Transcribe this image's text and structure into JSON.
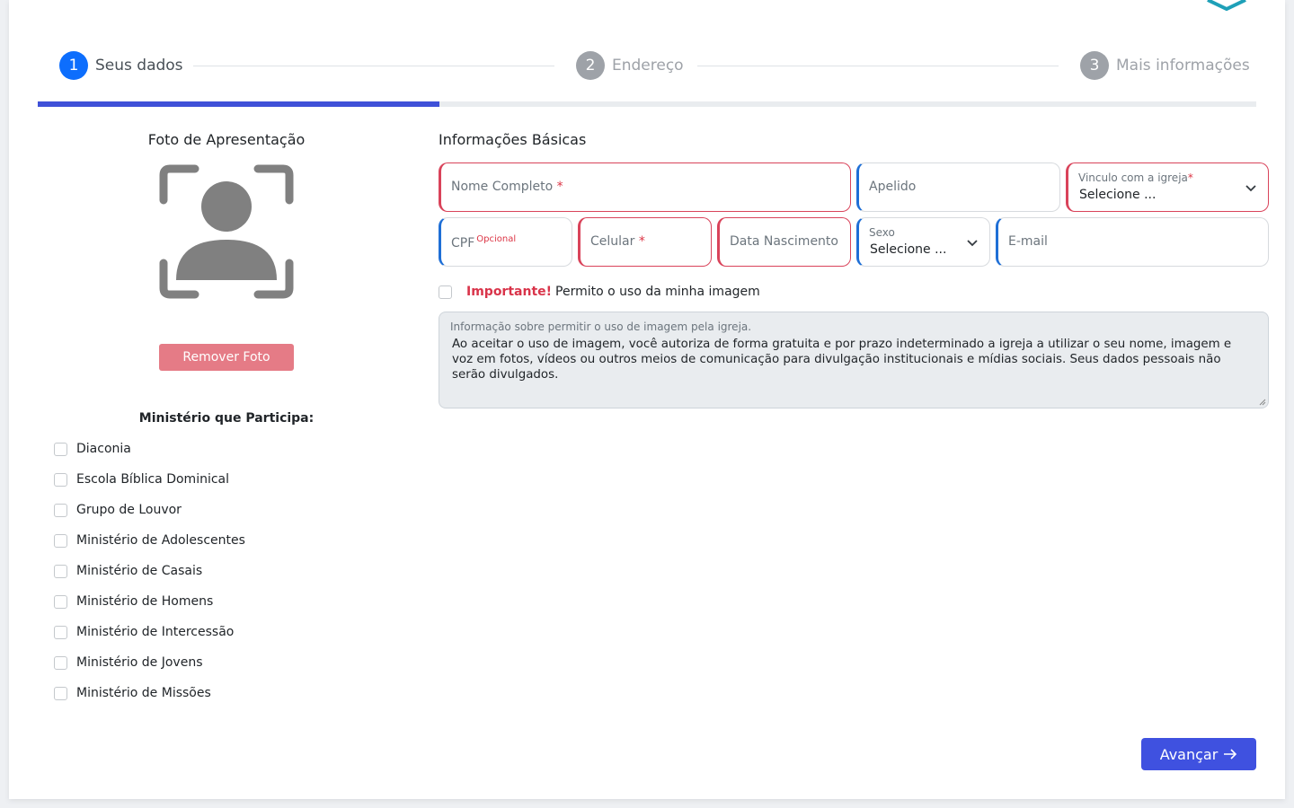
{
  "stepper": {
    "steps": [
      {
        "number": "1",
        "label": "Seus dados",
        "state": "active"
      },
      {
        "number": "2",
        "label": "Endereço",
        "state": "inactive"
      },
      {
        "number": "3",
        "label": "Mais informações",
        "state": "inactive"
      }
    ],
    "progress_fraction": 0.33
  },
  "photo": {
    "title": "Foto de Apresentação",
    "icon": "user-portrait-frame-icon",
    "remove_label": "Remover Foto"
  },
  "ministries": {
    "title": "Ministério que Participa:",
    "items": [
      "Diaconia",
      "Escola Bíblica Dominical",
      "Grupo de Louvor",
      "Ministério de Adolescentes",
      "Ministério de Casais",
      "Ministério de Homens",
      "Ministério de Intercessão",
      "Ministério de Jovens",
      "Ministério de Missões"
    ]
  },
  "form": {
    "title": "Informações Básicas",
    "full_name": {
      "placeholder": "Nome Completo",
      "required_mark": "*"
    },
    "nickname": {
      "placeholder": "Apelido"
    },
    "church_link": {
      "label": "Vinculo com a igreja",
      "required_mark": "*",
      "value": "Selecione ..."
    },
    "cpf": {
      "placeholder": "CPF",
      "optional_label": "Opcional"
    },
    "phone": {
      "placeholder": "Celular",
      "required_mark": "*"
    },
    "birth_date": {
      "placeholder": "Data Nascimento"
    },
    "sex": {
      "label": "Sexo",
      "value": "Selecione ..."
    },
    "email": {
      "placeholder": "E-mail"
    }
  },
  "consent": {
    "important": "Importante!",
    "text": "Permito o uso da minha imagem",
    "checked": false
  },
  "info": {
    "label": "Informação sobre permitir o uso de imagem pela igreja.",
    "text": "Ao aceitar o uso de imagem, você autoriza de forma gratuita e por prazo indeterminado a igreja a utilizar o seu nome, imagem e voz em fotos, vídeos ou outros meios de comunicação para divulgação institucionais e mídias sociais. Seus dados pessoais não serão divulgados."
  },
  "actions": {
    "next_label": "Avançar",
    "next_icon": "arrow-right-icon"
  },
  "colors": {
    "primary": "#0d6efd",
    "progress": "#3f51d8",
    "danger": "#dc3545",
    "remove_button": "#e57b86",
    "next_button": "#3f51e0"
  }
}
